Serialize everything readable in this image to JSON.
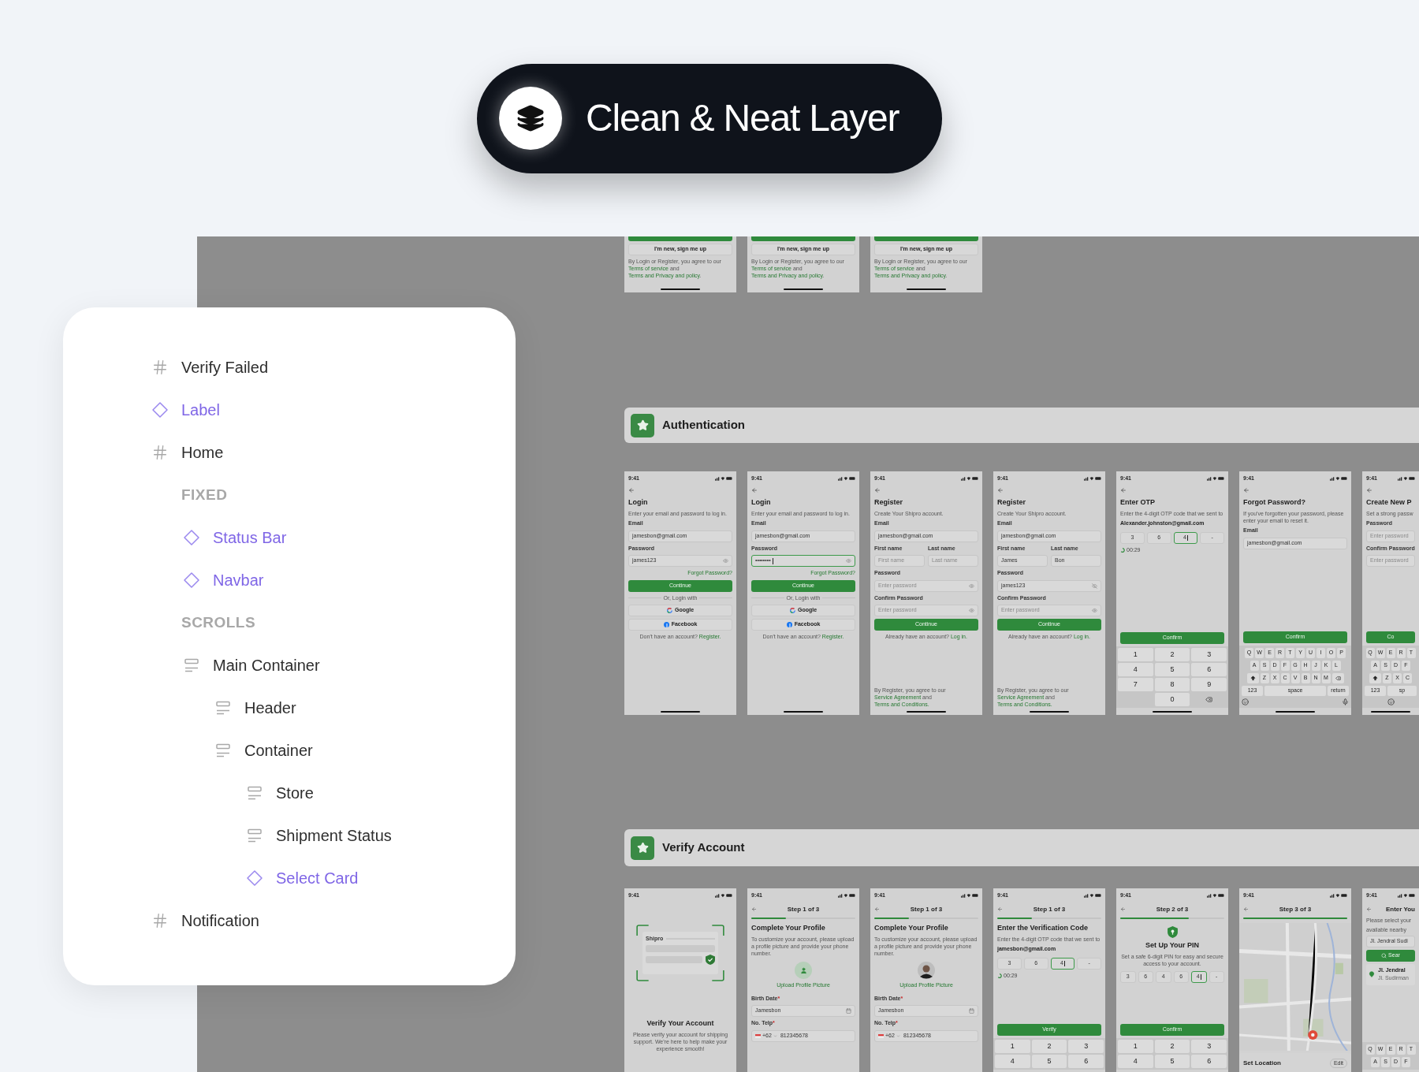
{
  "badge": {
    "title": "Clean & Neat Layer"
  },
  "layers": [
    {
      "kind": "frame",
      "name": "Verify Failed"
    },
    {
      "kind": "component",
      "name": "Label"
    },
    {
      "kind": "frame",
      "name": "Home",
      "children": [
        {
          "kind": "section",
          "name": "FIXED",
          "children": [
            {
              "kind": "component",
              "name": "Status Bar"
            },
            {
              "kind": "component",
              "name": "Navbar"
            }
          ]
        },
        {
          "kind": "section",
          "name": "SCROLLS",
          "children": [
            {
              "kind": "stack",
              "name": "Main Container",
              "children": [
                {
                  "kind": "stack",
                  "name": "Header"
                },
                {
                  "kind": "stack",
                  "name": "Container",
                  "children": [
                    {
                      "kind": "stack",
                      "name": "Store"
                    },
                    {
                      "kind": "stack",
                      "name": "Shipment Status"
                    },
                    {
                      "kind": "component",
                      "name": "Select Card"
                    }
                  ]
                }
              ]
            }
          ]
        }
      ]
    },
    {
      "kind": "frame",
      "name": "Notification"
    }
  ],
  "canvas": {
    "top_screens": [
      {
        "blocks": [
          {
            "kind": "bar"
          },
          {
            "kind": "outline",
            "label": "I'm new, sign me up"
          },
          {
            "kind": "legal",
            "parts": [
              {
                "kind": "plain",
                "text": "By Login or Register, you agree to our "
              },
              {
                "kind": "link",
                "text": "Terms of service"
              },
              {
                "kind": "plain",
                "text": " and "
              },
              {
                "kind": "link",
                "text": "Terms and Privacy and policy"
              },
              {
                "kind": "plain",
                "text": "."
              }
            ]
          },
          {
            "kind": "spacer"
          },
          {
            "kind": "home"
          }
        ]
      },
      {
        "blocks": [
          {
            "kind": "bar"
          },
          {
            "kind": "outline",
            "label": "I'm new, sign me up"
          },
          {
            "kind": "legal",
            "parts": [
              {
                "kind": "plain",
                "text": "By Login or Register, you agree to our "
              },
              {
                "kind": "link",
                "text": "Terms of service"
              },
              {
                "kind": "plain",
                "text": " and "
              },
              {
                "kind": "link",
                "text": "Terms and Privacy and policy"
              },
              {
                "kind": "plain",
                "text": "."
              }
            ]
          },
          {
            "kind": "spacer"
          },
          {
            "kind": "home"
          }
        ]
      },
      {
        "blocks": [
          {
            "kind": "bar"
          },
          {
            "kind": "outline",
            "label": "I'm new, sign me up"
          },
          {
            "kind": "legal",
            "parts": [
              {
                "kind": "plain",
                "text": "By Login or Register, you agree to our "
              },
              {
                "kind": "link",
                "text": "Terms of service"
              },
              {
                "kind": "plain",
                "text": " and "
              },
              {
                "kind": "link",
                "text": "Terms and Privacy and policy"
              },
              {
                "kind": "plain",
                "text": "."
              }
            ]
          },
          {
            "kind": "spacer"
          },
          {
            "kind": "home"
          }
        ]
      }
    ],
    "sections": [
      {
        "title": "Authentication",
        "screens": [
          {
            "blocks": [
              {
                "kind": "status",
                "time": "9:41"
              },
              {
                "kind": "back"
              },
              {
                "kind": "title",
                "text": "Login"
              },
              {
                "kind": "text",
                "text": "Enter your email and password to log in."
              },
              {
                "kind": "label",
                "text": "Email"
              },
              {
                "kind": "field",
                "value": "jamesbon@gmail.com",
                "focused": false
              },
              {
                "kind": "label",
                "text": "Password"
              },
              {
                "kind": "password",
                "value": "james123",
                "focused": false,
                "revealed": false
              },
              {
                "kind": "link",
                "text": "Forgot Password?"
              },
              {
                "kind": "button",
                "label": "Continue"
              },
              {
                "kind": "divider",
                "text": "Or, Login with"
              },
              {
                "kind": "google_login",
                "label": "Google"
              },
              {
                "kind": "facebook_login",
                "label": "Facebook"
              },
              {
                "kind": "note",
                "parts": [
                  {
                    "kind": "plain",
                    "text": "Don't have an account? "
                  },
                  {
                    "kind": "link",
                    "text": "Register."
                  }
                ]
              },
              {
                "kind": "spacer"
              },
              {
                "kind": "home"
              }
            ]
          },
          {
            "blocks": [
              {
                "kind": "status",
                "time": "9:41"
              },
              {
                "kind": "back"
              },
              {
                "kind": "title",
                "text": "Login"
              },
              {
                "kind": "text",
                "text": "Enter your email and password to log in."
              },
              {
                "kind": "label",
                "text": "Email"
              },
              {
                "kind": "field",
                "value": "jamesbon@gmail.com",
                "focused": false
              },
              {
                "kind": "label",
                "text": "Password"
              },
              {
                "kind": "password",
                "value": "••••••••",
                "focused": true,
                "revealed": false
              },
              {
                "kind": "link",
                "text": "Forgot Password?"
              },
              {
                "kind": "button",
                "label": "Continue"
              },
              {
                "kind": "divider",
                "text": "Or, Login with"
              },
              {
                "kind": "google_login",
                "label": "Google"
              },
              {
                "kind": "facebook_login",
                "label": "Facebook"
              },
              {
                "kind": "note",
                "parts": [
                  {
                    "kind": "plain",
                    "text": "Don't have an account? "
                  },
                  {
                    "kind": "link",
                    "text": "Register."
                  }
                ]
              },
              {
                "kind": "spacer"
              },
              {
                "kind": "home"
              }
            ]
          },
          {
            "blocks": [
              {
                "kind": "status",
                "time": "9:41"
              },
              {
                "kind": "back"
              },
              {
                "kind": "title",
                "text": "Register"
              },
              {
                "kind": "text",
                "text": "Create Your Shipro account."
              },
              {
                "kind": "label",
                "text": "Email"
              },
              {
                "kind": "field",
                "value": "jamesbon@gmail.com",
                "focused": false
              },
              {
                "kind": "split",
                "items": [
                  {
                    "label": "First name",
                    "placeholder": "First name"
                  },
                  {
                    "label": "Last name",
                    "placeholder": "Last name"
                  }
                ]
              },
              {
                "kind": "label",
                "text": "Password"
              },
              {
                "kind": "password",
                "placeholder": "Enter password",
                "focused": false,
                "revealed": false
              },
              {
                "kind": "label",
                "text": "Confirm Password"
              },
              {
                "kind": "password",
                "placeholder": "Enter password",
                "focused": false,
                "revealed": false
              },
              {
                "kind": "button",
                "label": "Continue"
              },
              {
                "kind": "note",
                "parts": [
                  {
                    "kind": "plain",
                    "text": "Already have an account? "
                  },
                  {
                    "kind": "link",
                    "text": "Log in."
                  }
                ]
              },
              {
                "kind": "spacer"
              },
              {
                "kind": "legal",
                "parts": [
                  {
                    "kind": "plain",
                    "text": "By Register, you agree to our "
                  },
                  {
                    "kind": "link",
                    "text": "Service Agreement"
                  },
                  {
                    "kind": "plain",
                    "text": " and "
                  },
                  {
                    "kind": "link",
                    "text": "Terms and Conditions."
                  }
                ]
              },
              {
                "kind": "home"
              }
            ]
          },
          {
            "blocks": [
              {
                "kind": "status",
                "time": "9:41"
              },
              {
                "kind": "back"
              },
              {
                "kind": "title",
                "text": "Register"
              },
              {
                "kind": "text",
                "text": "Create Your Shipro account."
              },
              {
                "kind": "label",
                "text": "Email"
              },
              {
                "kind": "field",
                "value": "jamesbon@gmail.com",
                "focused": false
              },
              {
                "kind": "split",
                "items": [
                  {
                    "label": "First name",
                    "value": "James"
                  },
                  {
                    "label": "Last name",
                    "value": "Bon"
                  }
                ]
              },
              {
                "kind": "label",
                "text": "Password"
              },
              {
                "kind": "password",
                "value": "james123",
                "focused": false,
                "revealed": true
              },
              {
                "kind": "label",
                "text": "Confirm Password"
              },
              {
                "kind": "password",
                "placeholder": "Enter password",
                "focused": false,
                "revealed": false
              },
              {
                "kind": "button",
                "label": "Continue"
              },
              {
                "kind": "note",
                "parts": [
                  {
                    "kind": "plain",
                    "text": "Already have an account? "
                  },
                  {
                    "kind": "link",
                    "text": "Log in."
                  }
                ]
              },
              {
                "kind": "spacer"
              },
              {
                "kind": "legal",
                "parts": [
                  {
                    "kind": "plain",
                    "text": "By Register, you agree to our "
                  },
                  {
                    "kind": "link",
                    "text": "Service Agreement"
                  },
                  {
                    "kind": "plain",
                    "text": " and "
                  },
                  {
                    "kind": "link",
                    "text": "Terms and Conditions."
                  }
                ]
              },
              {
                "kind": "home"
              }
            ]
          },
          {
            "blocks": [
              {
                "kind": "status",
                "time": "9:41"
              },
              {
                "kind": "back"
              },
              {
                "kind": "title",
                "text": "Enter OTP"
              },
              {
                "kind": "text",
                "text": "Enter the 4-digit OTP code that we sent to"
              },
              {
                "kind": "strong",
                "text": "Alexander.johnston@gmail.com"
              },
              {
                "kind": "otp",
                "cells": [
                  {
                    "value": "3",
                    "selected": false
                  },
                  {
                    "value": "6",
                    "selected": false
                  },
                  {
                    "value": "4",
                    "selected": true
                  },
                  {
                    "value": "-",
                    "selected": false
                  }
                ]
              },
              {
                "kind": "timer",
                "text": "00:29"
              },
              {
                "kind": "spacer"
              },
              {
                "kind": "button",
                "label": "Confirm"
              },
              {
                "kind": "keypad",
                "keys": [
                  {
                    "kind": "digit",
                    "label": "1"
                  },
                  {
                    "kind": "digit",
                    "label": "2"
                  },
                  {
                    "kind": "digit",
                    "label": "3"
                  },
                  {
                    "kind": "digit",
                    "label": "4"
                  },
                  {
                    "kind": "digit",
                    "label": "5"
                  },
                  {
                    "kind": "digit",
                    "label": "6"
                  },
                  {
                    "kind": "digit",
                    "label": "7"
                  },
                  {
                    "kind": "digit",
                    "label": "8"
                  },
                  {
                    "kind": "digit",
                    "label": "9"
                  },
                  {
                    "kind": "blank"
                  },
                  {
                    "kind": "digit",
                    "label": "0"
                  },
                  {
                    "kind": "backspace"
                  }
                ]
              },
              {
                "kind": "home"
              }
            ]
          },
          {
            "blocks": [
              {
                "kind": "status",
                "time": "9:41"
              },
              {
                "kind": "back"
              },
              {
                "kind": "title",
                "text": "Forgot Password?"
              },
              {
                "kind": "text",
                "text": "If you've forgotten your password, please enter your email to reset it."
              },
              {
                "kind": "label",
                "text": "Email"
              },
              {
                "kind": "field",
                "value": "jamesbon@gmail.com",
                "focused": false
              },
              {
                "kind": "spacer"
              },
              {
                "kind": "button",
                "label": "Confirm"
              },
              {
                "kind": "keyboard",
                "rows": [
                  {
                    "keys": [
                      {
                        "kind": "letter",
                        "label": "Q"
                      },
                      {
                        "kind": "letter",
                        "label": "W"
                      },
                      {
                        "kind": "letter",
                        "label": "E"
                      },
                      {
                        "kind": "letter",
                        "label": "R"
                      },
                      {
                        "kind": "letter",
                        "label": "T"
                      },
                      {
                        "kind": "letter",
                        "label": "Y"
                      },
                      {
                        "kind": "letter",
                        "label": "U"
                      },
                      {
                        "kind": "letter",
                        "label": "I"
                      },
                      {
                        "kind": "letter",
                        "label": "O"
                      },
                      {
                        "kind": "letter",
                        "label": "P"
                      }
                    ]
                  },
                  {
                    "keys": [
                      {
                        "kind": "letter",
                        "label": "A"
                      },
                      {
                        "kind": "letter",
                        "label": "S"
                      },
                      {
                        "kind": "letter",
                        "label": "D"
                      },
                      {
                        "kind": "letter",
                        "label": "F"
                      },
                      {
                        "kind": "letter",
                        "label": "G"
                      },
                      {
                        "kind": "letter",
                        "label": "H"
                      },
                      {
                        "kind": "letter",
                        "label": "J"
                      },
                      {
                        "kind": "letter",
                        "label": "K"
                      },
                      {
                        "kind": "letter",
                        "label": "L"
                      }
                    ]
                  },
                  {
                    "keys": [
                      {
                        "kind": "shift"
                      },
                      {
                        "kind": "letter",
                        "label": "Z"
                      },
                      {
                        "kind": "letter",
                        "label": "X"
                      },
                      {
                        "kind": "letter",
                        "label": "C"
                      },
                      {
                        "kind": "letter",
                        "label": "V"
                      },
                      {
                        "kind": "letter",
                        "label": "B"
                      },
                      {
                        "kind": "letter",
                        "label": "N"
                      },
                      {
                        "kind": "letter",
                        "label": "M"
                      },
                      {
                        "kind": "backspace"
                      }
                    ]
                  },
                  {
                    "keys": [
                      {
                        "kind": "wide",
                        "label": "123"
                      },
                      {
                        "kind": "space",
                        "label": "space"
                      },
                      {
                        "kind": "wide",
                        "label": "return"
                      }
                    ]
                  },
                  {
                    "keys": [
                      {
                        "kind": "emoji"
                      },
                      {
                        "kind": "mic"
                      }
                    ]
                  }
                ]
              },
              {
                "kind": "home"
              }
            ]
          },
          {
            "blocks": [
              {
                "kind": "status",
                "time": "9:41"
              },
              {
                "kind": "back"
              },
              {
                "kind": "title",
                "text": "Create New P"
              },
              {
                "kind": "text",
                "text": "Set a strong passw"
              },
              {
                "kind": "label",
                "text": "Password"
              },
              {
                "kind": "field",
                "placeholder": "Enter password",
                "focused": false
              },
              {
                "kind": "label",
                "text": "Confirm Password"
              },
              {
                "kind": "field",
                "placeholder": "Enter password",
                "focused": false
              },
              {
                "kind": "spacer"
              },
              {
                "kind": "button",
                "label": "Co"
              },
              {
                "kind": "keyboard",
                "rows": [
                  {
                    "keys": [
                      {
                        "kind": "letter",
                        "label": "Q"
                      },
                      {
                        "kind": "letter",
                        "label": "W"
                      },
                      {
                        "kind": "letter",
                        "label": "E"
                      },
                      {
                        "kind": "letter",
                        "label": "R"
                      },
                      {
                        "kind": "letter",
                        "label": "T"
                      }
                    ]
                  },
                  {
                    "keys": [
                      {
                        "kind": "letter",
                        "label": "A"
                      },
                      {
                        "kind": "letter",
                        "label": "S"
                      },
                      {
                        "kind": "letter",
                        "label": "D"
                      },
                      {
                        "kind": "letter",
                        "label": "F"
                      }
                    ]
                  },
                  {
                    "keys": [
                      {
                        "kind": "shift"
                      },
                      {
                        "kind": "letter",
                        "label": "Z"
                      },
                      {
                        "kind": "letter",
                        "label": "X"
                      },
                      {
                        "kind": "letter",
                        "label": "C"
                      }
                    ]
                  },
                  {
                    "keys": [
                      {
                        "kind": "wide",
                        "label": "123"
                      },
                      {
                        "kind": "space",
                        "label": "sp"
                      }
                    ]
                  },
                  {
                    "keys": [
                      {
                        "kind": "emoji"
                      }
                    ]
                  }
                ]
              },
              {
                "kind": "home"
              }
            ]
          }
        ]
      },
      {
        "title": "Verify Account",
        "screens": [
          {
            "blocks": [
              {
                "kind": "status",
                "time": "9:41"
              },
              {
                "kind": "illustration",
                "brand": "Shipro"
              },
              {
                "kind": "headline",
                "text": "Verify Your Account"
              },
              {
                "kind": "center_text",
                "text": "Please verify your account for shipping support. We're here to help make your experience smooth!"
              }
            ]
          },
          {
            "blocks": [
              {
                "kind": "status",
                "time": "9:41"
              },
              {
                "kind": "stepbar",
                "title": "Step 1 of 3",
                "level": 0.33
              },
              {
                "kind": "title",
                "text": "Complete Your Profile"
              },
              {
                "kind": "text",
                "text": "To customize your account, please upload a profile picture and provide your phone number."
              },
              {
                "kind": "avatar",
                "label": "Upload Profile Picture",
                "photo": false
              },
              {
                "kind": "label",
                "text": "Birth Date",
                "marker": "*"
              },
              {
                "kind": "date",
                "value": "Jamesbon",
                "focused": false
              },
              {
                "kind": "label",
                "text": "No. Telp",
                "marker": "*"
              },
              {
                "kind": "phone",
                "code": "+62",
                "value": "812345678"
              }
            ]
          },
          {
            "blocks": [
              {
                "kind": "status",
                "time": "9:41"
              },
              {
                "kind": "stepbar",
                "title": "Step 1 of 3",
                "level": 0.33
              },
              {
                "kind": "title",
                "text": "Complete Your Profile"
              },
              {
                "kind": "text",
                "text": "To customize your account, please upload a profile picture and provide your phone number."
              },
              {
                "kind": "avatar",
                "label": "Upload Profile Picture",
                "photo": true
              },
              {
                "kind": "label",
                "text": "Birth Date",
                "marker": "*"
              },
              {
                "kind": "date",
                "value": "Jamesbon",
                "focused": false
              },
              {
                "kind": "label",
                "text": "No. Telp",
                "marker": "*"
              },
              {
                "kind": "phone",
                "code": "+62",
                "value": "812345678"
              }
            ]
          },
          {
            "blocks": [
              {
                "kind": "status",
                "time": "9:41"
              },
              {
                "kind": "stepbar",
                "title": "Step 1 of 3",
                "level": 0.33
              },
              {
                "kind": "title",
                "text": "Enter the Verification Code"
              },
              {
                "kind": "text",
                "text": "Enter the 4-digit OTP code that we sent to"
              },
              {
                "kind": "strong",
                "text": "jamesbon@gmail.com"
              },
              {
                "kind": "otp",
                "cells": [
                  {
                    "value": "3",
                    "selected": false
                  },
                  {
                    "value": "6",
                    "selected": false
                  },
                  {
                    "value": "4",
                    "selected": true
                  },
                  {
                    "value": "-",
                    "selected": false
                  }
                ]
              },
              {
                "kind": "timer",
                "text": "00:29"
              },
              {
                "kind": "spacer"
              },
              {
                "kind": "button",
                "label": "Verify"
              },
              {
                "kind": "keypad",
                "keys": [
                  {
                    "kind": "digit",
                    "label": "1"
                  },
                  {
                    "kind": "digit",
                    "label": "2"
                  },
                  {
                    "kind": "digit",
                    "label": "3"
                  },
                  {
                    "kind": "digit",
                    "label": "4"
                  },
                  {
                    "kind": "digit",
                    "label": "5"
                  },
                  {
                    "kind": "digit",
                    "label": "6"
                  }
                ]
              }
            ]
          },
          {
            "blocks": [
              {
                "kind": "status",
                "time": "9:41"
              },
              {
                "kind": "stepbar",
                "title": "Step 2 of 3",
                "level": 0.66
              },
              {
                "kind": "shield"
              },
              {
                "kind": "headline",
                "text": "Set Up Your PIN"
              },
              {
                "kind": "center_text",
                "text": "Set a safe 6-digit PIN for easy and secure access to your account."
              },
              {
                "kind": "otp",
                "cells": [
                  {
                    "value": "3",
                    "selected": false
                  },
                  {
                    "value": "6",
                    "selected": false
                  },
                  {
                    "value": "4",
                    "selected": false
                  },
                  {
                    "value": "6",
                    "selected": false
                  },
                  {
                    "value": "4",
                    "selected": true
                  },
                  {
                    "value": "-",
                    "selected": false
                  }
                ]
              },
              {
                "kind": "spacer"
              },
              {
                "kind": "button",
                "label": "Confirm"
              },
              {
                "kind": "keypad",
                "keys": [
                  {
                    "kind": "digit",
                    "label": "1"
                  },
                  {
                    "kind": "digit",
                    "label": "2"
                  },
                  {
                    "kind": "digit",
                    "label": "3"
                  },
                  {
                    "kind": "digit",
                    "label": "4"
                  },
                  {
                    "kind": "digit",
                    "label": "5"
                  },
                  {
                    "kind": "digit",
                    "label": "6"
                  }
                ]
              }
            ]
          },
          {
            "blocks": [
              {
                "kind": "status",
                "time": "9:41"
              },
              {
                "kind": "stepbar",
                "title": "Step 3 of 3",
                "level": 1
              },
              {
                "kind": "map"
              },
              {
                "kind": "sheet",
                "title": "Set Location",
                "action": "Edit"
              }
            ]
          },
          {
            "blocks": [
              {
                "kind": "status",
                "time": "9:41"
              },
              {
                "kind": "navtitle",
                "title": "Enter You"
              },
              {
                "kind": "text",
                "text": "Please select your"
              },
              {
                "kind": "text",
                "text": "available nearby"
              },
              {
                "kind": "field",
                "value": "Jl. Jendral Sudi",
                "focused": false
              },
              {
                "kind": "search_button",
                "label": "Sear"
              },
              {
                "kind": "place",
                "title": "Jl. Jendral",
                "subtitle": "Jl. Sudirman"
              },
              {
                "kind": "spacer"
              },
              {
                "kind": "keyboard",
                "rows": [
                  {
                    "keys": [
                      {
                        "kind": "letter",
                        "label": "Q"
                      },
                      {
                        "kind": "letter",
                        "label": "W"
                      },
                      {
                        "kind": "letter",
                        "label": "E"
                      },
                      {
                        "kind": "letter",
                        "label": "R"
                      },
                      {
                        "kind": "letter",
                        "label": "T"
                      }
                    ]
                  },
                  {
                    "keys": [
                      {
                        "kind": "letter",
                        "label": "A"
                      },
                      {
                        "kind": "letter",
                        "label": "S"
                      },
                      {
                        "kind": "letter",
                        "label": "D"
                      },
                      {
                        "kind": "letter",
                        "label": "F"
                      }
                    ]
                  }
                ]
              }
            ]
          }
        ]
      }
    ]
  }
}
